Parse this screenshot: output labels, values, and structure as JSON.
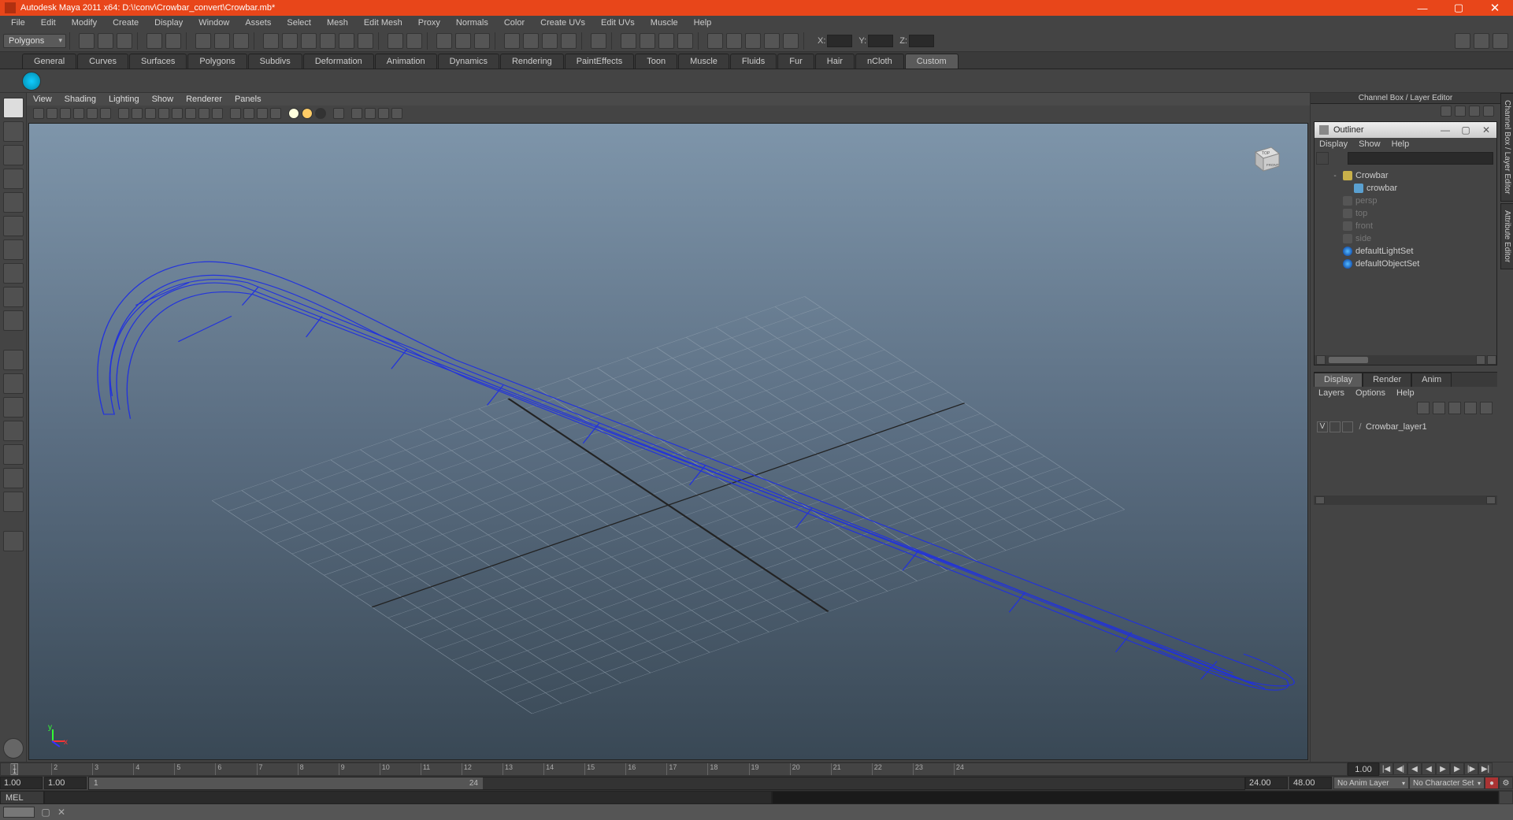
{
  "window": {
    "title": "Autodesk Maya 2011 x64: D:\\!conv\\Crowbar_convert\\Crowbar.mb*"
  },
  "menubar": [
    "File",
    "Edit",
    "Modify",
    "Create",
    "Display",
    "Window",
    "Assets",
    "Select",
    "Mesh",
    "Edit Mesh",
    "Proxy",
    "Normals",
    "Color",
    "Create UVs",
    "Edit UVs",
    "Muscle",
    "Help"
  ],
  "mode": "Polygons",
  "coords": {
    "xlabel": "X:",
    "ylabel": "Y:",
    "zlabel": "Z:"
  },
  "shelf_tabs": [
    "General",
    "Curves",
    "Surfaces",
    "Polygons",
    "Subdivs",
    "Deformation",
    "Animation",
    "Dynamics",
    "Rendering",
    "PaintEffects",
    "Toon",
    "Muscle",
    "Fluids",
    "Fur",
    "Hair",
    "nCloth",
    "Custom"
  ],
  "shelf_active": "Custom",
  "panel_menu": [
    "View",
    "Shading",
    "Lighting",
    "Show",
    "Renderer",
    "Panels"
  ],
  "channel_title": "Channel Box / Layer Editor",
  "outliner": {
    "title": "Outliner",
    "menu": [
      "Display",
      "Show",
      "Help"
    ],
    "items": [
      {
        "label": "Crowbar",
        "type": "grp",
        "indent": 1,
        "exp": "-"
      },
      {
        "label": "crowbar",
        "type": "mesh",
        "indent": 2,
        "exp": ""
      },
      {
        "label": "persp",
        "type": "cam",
        "indent": 1,
        "exp": "",
        "muted": true
      },
      {
        "label": "top",
        "type": "cam",
        "indent": 1,
        "exp": "",
        "muted": true
      },
      {
        "label": "front",
        "type": "cam",
        "indent": 1,
        "exp": "",
        "muted": true
      },
      {
        "label": "side",
        "type": "cam",
        "indent": 1,
        "exp": "",
        "muted": true
      },
      {
        "label": "defaultLightSet",
        "type": "set",
        "indent": 1,
        "exp": ""
      },
      {
        "label": "defaultObjectSet",
        "type": "set",
        "indent": 1,
        "exp": ""
      }
    ]
  },
  "layer_tabs": [
    "Display",
    "Render",
    "Anim"
  ],
  "layer_active": "Display",
  "layer_menu": [
    "Layers",
    "Options",
    "Help"
  ],
  "layers": [
    {
      "vis": "V",
      "name": "Crowbar_layer1"
    }
  ],
  "time": {
    "current_frame": "1",
    "range_start": "1.00",
    "range_end": "24.00",
    "anim_start": "1.00",
    "anim_end": "48.00",
    "handle_start": "1",
    "handle_end": "24",
    "frame_field": "1.00",
    "anim_layer": "No Anim Layer",
    "char_set": "No Character Set",
    "ticks": [
      "1",
      "2",
      "3",
      "4",
      "5",
      "6",
      "7",
      "8",
      "9",
      "10",
      "11",
      "12",
      "13",
      "14",
      "15",
      "16",
      "17",
      "18",
      "19",
      "20",
      "21",
      "22",
      "23",
      "24"
    ]
  },
  "cmd": {
    "label": "MEL"
  },
  "edge_tabs": [
    "Channel Box / Layer Editor",
    "Attribute Editor"
  ],
  "viewcube": {
    "top": "TOP",
    "front": "FRONT"
  }
}
